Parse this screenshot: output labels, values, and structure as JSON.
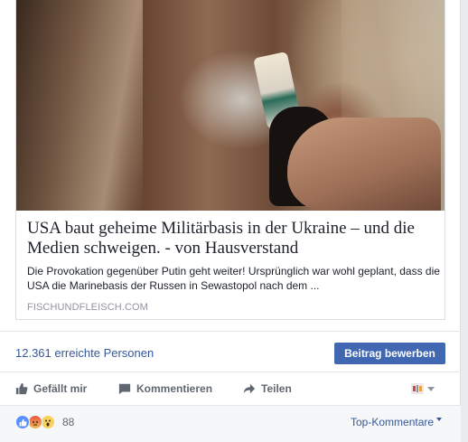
{
  "link_preview": {
    "title": "USA baut geheime Militärbasis in der Ukraine – und die Medien schweigen. - von Hausverstand",
    "description": "Die Provokation gegenüber Putin geht weiter! Ursprünglich war wohl geplant, dass die USA die Marinebasis der Russen in Sewastopol nach dem ...",
    "domain": "FISCHUNDFLEISCH.COM"
  },
  "insights": {
    "reach_text": "12.361 erreichte Personen",
    "boost_label": "Beitrag bewerben"
  },
  "actions": {
    "like_label": "Gefällt mir",
    "comment_label": "Kommentieren",
    "share_label": "Teilen",
    "like_icon": "thumbs-up-icon",
    "comment_icon": "speech-bubble-icon",
    "share_icon": "share-arrow-icon"
  },
  "reactions": {
    "types": [
      "like",
      "angry",
      "wow"
    ],
    "count": "88",
    "comments_filter": "Top-Kommentare"
  },
  "colors": {
    "link": "#365899",
    "button": "#4267b2",
    "muted": "#606770",
    "domain": "#90949c"
  }
}
